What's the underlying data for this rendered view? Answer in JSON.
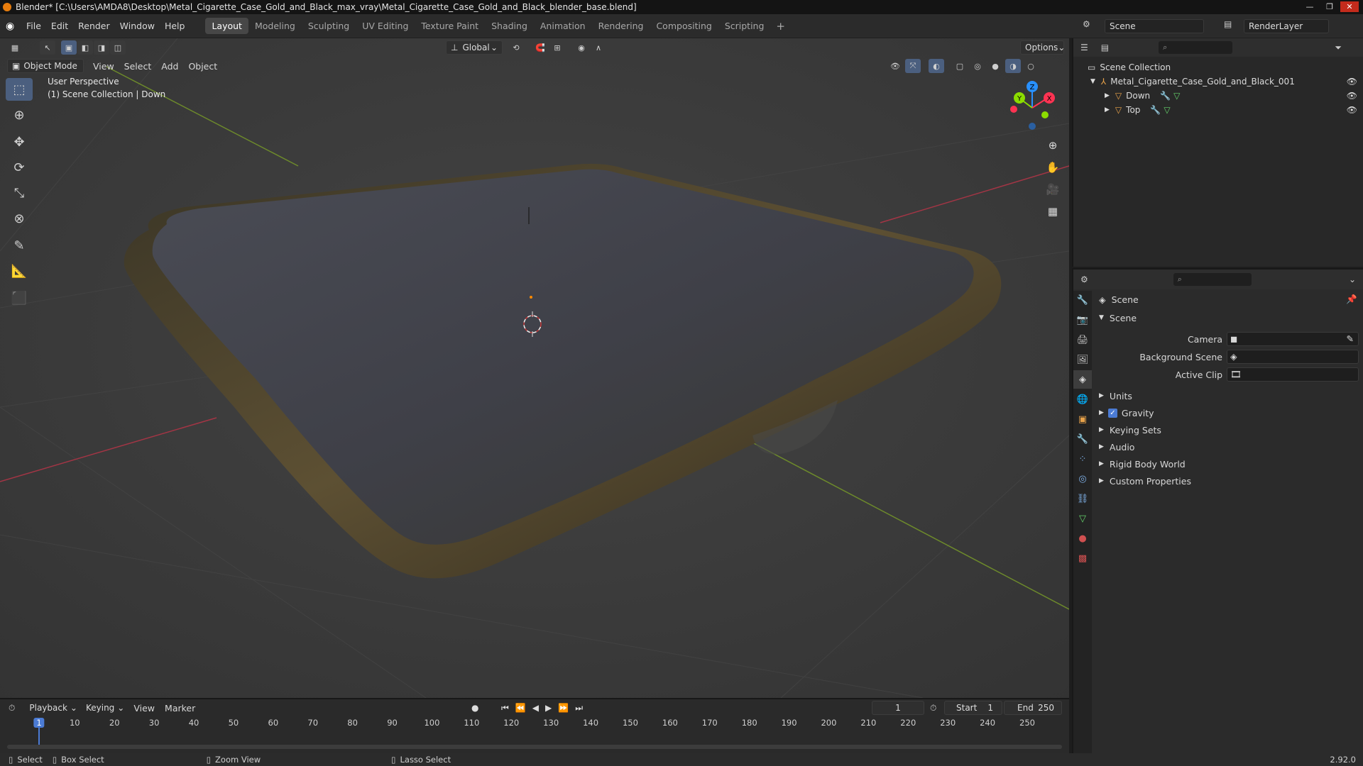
{
  "window": {
    "title": "Blender* [C:\\Users\\AMDA8\\Desktop\\Metal_Cigarette_Case_Gold_and_Black_max_vray\\Metal_Cigarette_Case_Gold_and_Black_blender_base.blend]"
  },
  "menu": [
    "File",
    "Edit",
    "Render",
    "Window",
    "Help"
  ],
  "workspaces": [
    "Layout",
    "Modeling",
    "Sculpting",
    "UV Editing",
    "Texture Paint",
    "Shading",
    "Animation",
    "Rendering",
    "Compositing",
    "Scripting"
  ],
  "active_workspace": "Layout",
  "scene_name": "Scene",
  "render_layer": "RenderLayer",
  "viewport": {
    "transform_orientation": "Global",
    "options_label": "Options",
    "mode": "Object Mode",
    "header_menu": [
      "View",
      "Select",
      "Add",
      "Object"
    ],
    "perspective_label": "User Perspective",
    "collection_label": "(1) Scene Collection | Down",
    "gizmo_axes": [
      "X",
      "Y",
      "Z"
    ]
  },
  "outliner": {
    "root": "Scene Collection",
    "object": "Metal_Cigarette_Case_Gold_and_Black_001",
    "children": [
      "Down",
      "Top"
    ]
  },
  "properties": {
    "header_title": "Scene",
    "panel_title": "Scene",
    "fields": [
      {
        "label": "Camera"
      },
      {
        "label": "Background Scene"
      },
      {
        "label": "Active Clip"
      }
    ],
    "sections": [
      "Units",
      "Gravity",
      "Keying Sets",
      "Audio",
      "Rigid Body World",
      "Custom Properties"
    ],
    "gravity_checked": true
  },
  "timeline": {
    "menu": [
      "Playback",
      "Keying",
      "View",
      "Marker"
    ],
    "current_frame": "1",
    "start_label": "Start",
    "start": "1",
    "end_label": "End",
    "end": "250",
    "ticks": [
      "1",
      "10",
      "20",
      "30",
      "40",
      "50",
      "60",
      "70",
      "80",
      "90",
      "100",
      "110",
      "120",
      "130",
      "140",
      "150",
      "160",
      "170",
      "180",
      "190",
      "200",
      "210",
      "220",
      "230",
      "240",
      "250"
    ]
  },
  "statusbar": {
    "items": [
      "Select",
      "Box Select",
      "Zoom View",
      "Lasso Select"
    ],
    "version": "2.92.0"
  },
  "colors": {
    "accent_blue": "#4b5f7f",
    "axis_x": "#ff3352",
    "axis_y": "#8bdc00",
    "axis_z": "#2890ff",
    "object_gold": "#5a4f33"
  }
}
